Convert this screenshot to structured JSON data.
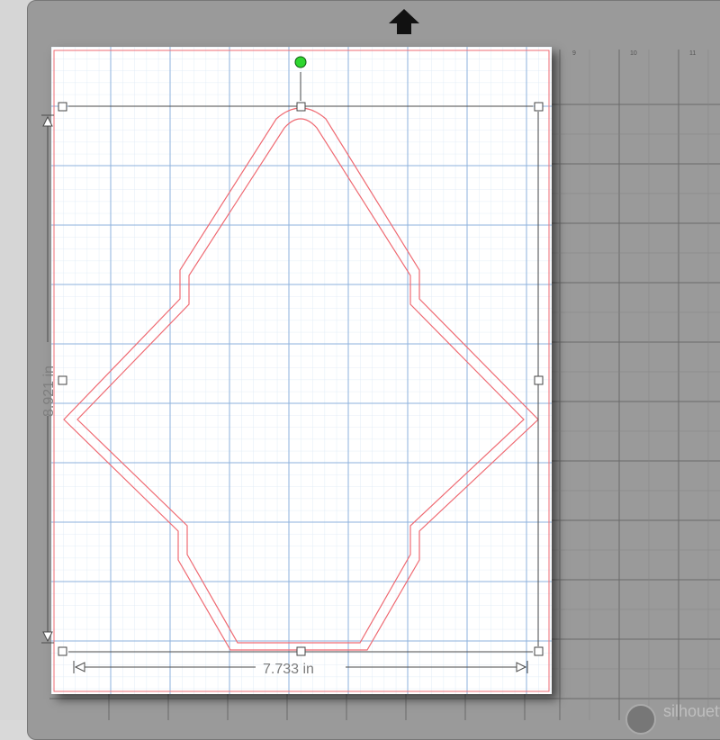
{
  "document": {
    "width_label": "7.733 in",
    "height_label": "8.921 in"
  },
  "mat_ruler": {
    "marks": [
      "9",
      "10",
      "11"
    ]
  },
  "brand": {
    "text": "silhouette"
  },
  "colors": {
    "cut_line": "#ef6b73",
    "rotate_handle": "#2fd62f",
    "grid_major": "#8db2dc",
    "grid_minor": "#dbe8f5",
    "mat": "#9a9a9a"
  },
  "icons": {
    "scroll_up": "up-arrow-icon",
    "rotate": "rotate-handle-icon",
    "brand_logo": "silhouette-logo-icon"
  }
}
